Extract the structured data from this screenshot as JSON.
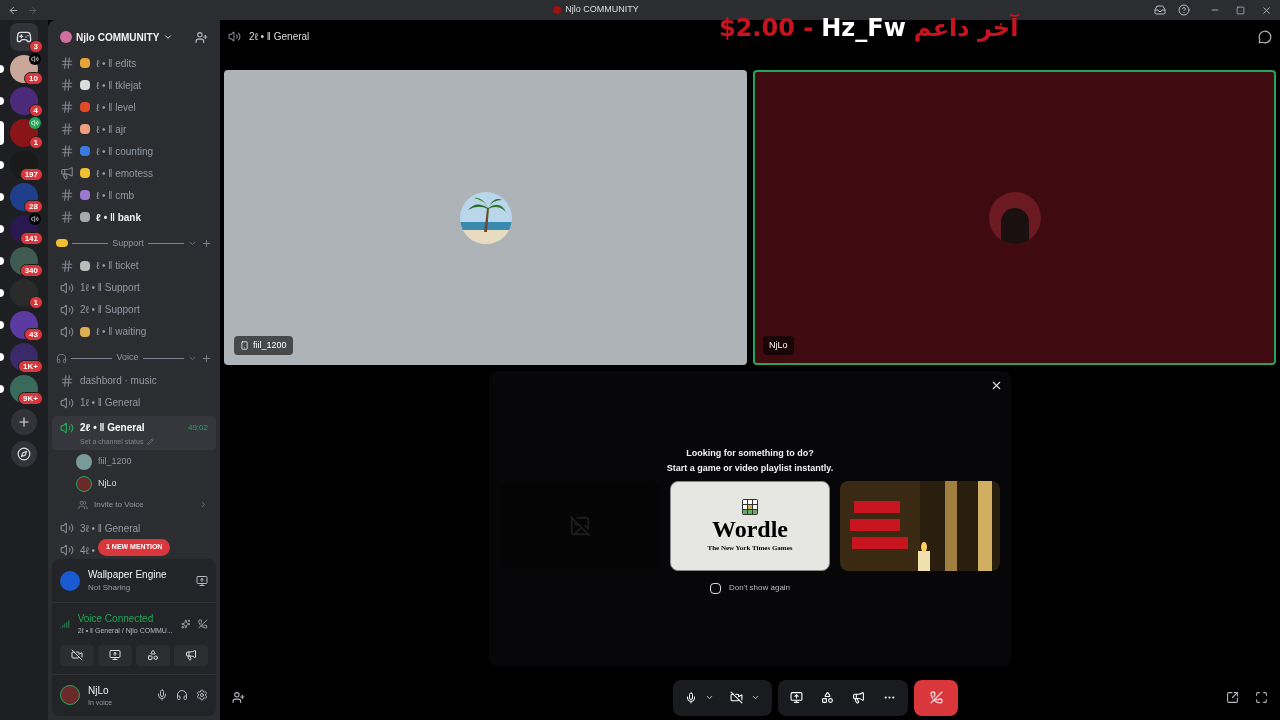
{
  "titlebar": {
    "title": "Njlo COMMUNITY"
  },
  "servers": [
    {
      "kind": "home",
      "badge": "3",
      "selected": false,
      "unread": false,
      "voice": false,
      "color": "#313338"
    },
    {
      "kind": "server",
      "badge": "10",
      "selected": false,
      "unread": true,
      "voice": true,
      "color": "#c9a89a"
    },
    {
      "kind": "server",
      "badge": "4",
      "selected": false,
      "unread": true,
      "voice": false,
      "color": "#4b2a7a"
    },
    {
      "kind": "server",
      "badge": "1",
      "selected": true,
      "voice": true,
      "color": "#8a1518"
    },
    {
      "kind": "server",
      "badge": "197",
      "selected": false,
      "unread": true,
      "voice": false,
      "color": "#1a1a1a"
    },
    {
      "kind": "server",
      "badge": "28",
      "selected": false,
      "unread": true,
      "voice": false,
      "color": "#1f3f8a"
    },
    {
      "kind": "server",
      "badge": "141",
      "selected": false,
      "unread": true,
      "voice": true,
      "color": "#2a1850"
    },
    {
      "kind": "server",
      "badge": "340",
      "selected": false,
      "unread": true,
      "voice": false,
      "color": "#3f5a50"
    },
    {
      "kind": "server",
      "badge": "1",
      "selected": false,
      "unread": true,
      "voice": false,
      "color": "#2a2a2a"
    },
    {
      "kind": "server",
      "badge": "43",
      "selected": false,
      "unread": true,
      "voice": false,
      "color": "#5a3aa0"
    },
    {
      "kind": "server",
      "badge": "1K+",
      "selected": false,
      "unread": true,
      "voice": false,
      "color": "#3a2a6a"
    },
    {
      "kind": "server",
      "badge": "9K+",
      "selected": false,
      "unread": true,
      "voice": false,
      "color": "#3a6a5a"
    }
  ],
  "sidebar": {
    "server_name": "Njlo COMMUNITY",
    "items": [
      {
        "kind": "text",
        "label": "ℓ • ǁ edits",
        "unread": false,
        "color": "#e8a33a"
      },
      {
        "kind": "text",
        "label": "ℓ • ǁ tklejat",
        "unread": false,
        "color": "#dddddd"
      },
      {
        "kind": "text",
        "label": "ℓ • ǁ level",
        "unread": false,
        "color": "#e24a2a"
      },
      {
        "kind": "text",
        "label": "ℓ • ǁ ajr",
        "unread": false,
        "color": "#f0a080"
      },
      {
        "kind": "text",
        "label": "ℓ • ǁ counting",
        "unread": false,
        "color": "#3a7ae0"
      },
      {
        "kind": "announce",
        "label": "ℓ • ǁ emotess",
        "unread": false,
        "color": "#f0c030"
      },
      {
        "kind": "text",
        "label": "ℓ • ǁ cmb",
        "unread": false,
        "color": "#9a7ad0"
      },
      {
        "kind": "text",
        "label": "ℓ • ǁ bank",
        "unread": true,
        "color": "#aaaaaa"
      },
      {
        "kind": "category",
        "label": "Support"
      },
      {
        "kind": "text",
        "label": "ℓ • ǁ ticket",
        "unread": false,
        "color": "#bbbbbb"
      },
      {
        "kind": "voice",
        "label": "1ℓ • ǁ Support",
        "selected": false
      },
      {
        "kind": "voice",
        "label": "2ℓ • ǁ Support",
        "selected": false
      },
      {
        "kind": "voice",
        "label": "ℓ • ǁ waiting",
        "selected": false,
        "color": "#e0b050"
      },
      {
        "kind": "category",
        "label": "Voice"
      },
      {
        "kind": "text",
        "label": "dashbord · music",
        "unread": false
      },
      {
        "kind": "voice",
        "label": "1ℓ • ǁ General",
        "selected": false
      },
      {
        "kind": "voice",
        "label": "2ℓ • ǁ General",
        "selected": true,
        "timer": "49:02",
        "status_hint": "Set a channel status",
        "members": [
          "fiil_1200",
          "NjLo"
        ],
        "invite": "Invite to Voice"
      },
      {
        "kind": "voice",
        "label": "3ℓ • ǁ General",
        "selected": false
      },
      {
        "kind": "voice",
        "label": "4ℓ •",
        "selected": false,
        "mention": "1 NEW MENTION"
      }
    ]
  },
  "activity_panel": {
    "app": "Wallpaper Engine",
    "status": "Not Sharing"
  },
  "voice_panel": {
    "title": "Voice Connected",
    "channel": "2ℓ • ǁ General / Njlo COMMU..."
  },
  "user_panel": {
    "name": "NjLo",
    "status": "In voice"
  },
  "call": {
    "channel": "2ℓ • ǁ General",
    "overlay": [
      {
        "text": "$2.00 -",
        "color": "#c8141e"
      },
      {
        "text": "Hz_Fw",
        "color": "#ffffff"
      },
      {
        "text": "آخر داعم",
        "color": "#c8141e"
      }
    ],
    "tiles": [
      {
        "name": "fiil_1200",
        "speaking": false,
        "kind": "mobile"
      },
      {
        "name": "NjLo",
        "speaking": true,
        "kind": "desktop"
      }
    ],
    "activities": {
      "heading": "Looking for something to do?",
      "subheading": "Start a game or video playlist instantly.",
      "cards": [
        {
          "kind": "broken"
        },
        {
          "kind": "wordle",
          "title": "Wordle",
          "publisher": "The New York Times Games"
        },
        {
          "kind": "picture"
        }
      ],
      "dont_show": {
        "label": "Don't show again",
        "checked": false
      }
    }
  }
}
